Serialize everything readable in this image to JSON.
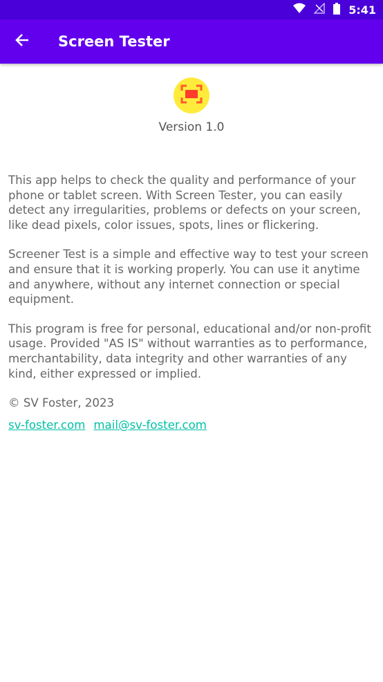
{
  "status_bar": {
    "time": "5:41",
    "icons": [
      "wifi-icon",
      "no-signal-icon",
      "battery-icon"
    ]
  },
  "app_bar": {
    "title": "Screen Tester",
    "back_icon": "arrow-back-icon",
    "color": "#6200ee"
  },
  "header": {
    "logo_icon": "screen-frame-icon",
    "version": "Version 1.0"
  },
  "content": {
    "paragraphs": [
      "This app helps to check the quality and performance of your phone or tablet screen. With Screen Tester, you can easily detect any irregularities, problems or defects on your screen, like dead pixels, color issues, spots, lines or flickering.",
      "Screener Test is a simple and effective way to test your screen and ensure that it is working properly. You can use it anytime and anywhere, without any internet connection or special equipment.",
      "This program is free for personal, educational and/or non-profit usage. Provided \"AS IS\" without warranties as to performance, merchantability, data integrity and other warranties of any kind, either expressed or implied."
    ],
    "copyright": "© SV Foster, 2023",
    "links": [
      "sv-foster.com",
      "mail@sv-foster.com"
    ],
    "link_color": "#00bfa5"
  }
}
